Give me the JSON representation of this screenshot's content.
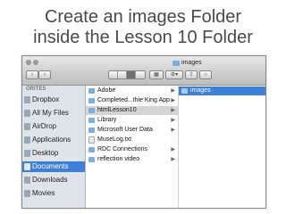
{
  "slide": {
    "title_line1": "Create an images Folder",
    "title_line2": "inside the Lesson 10 Folder"
  },
  "window": {
    "title": "images",
    "title_icon": "folder-icon"
  },
  "toolbar": {
    "view_modes": [
      "icon-view",
      "list-view",
      "column-view",
      "coverflow-view"
    ],
    "active_view": "column-view",
    "action_icon": "gear-icon",
    "arrange_icon": "grid-icon"
  },
  "sidebar": {
    "header": "ORITES",
    "items": [
      {
        "label": "Dropbox",
        "icon": "dropbox-icon"
      },
      {
        "label": "All My Files",
        "icon": "all-files-icon"
      },
      {
        "label": "AirDrop",
        "icon": "airdrop-icon"
      },
      {
        "label": "Applications",
        "icon": "applications-icon"
      },
      {
        "label": "Desktop",
        "icon": "desktop-icon"
      },
      {
        "label": "Documents",
        "icon": "documents-icon",
        "selected": true
      },
      {
        "label": "Downloads",
        "icon": "downloads-icon"
      },
      {
        "label": "Movies",
        "icon": "movies-icon"
      }
    ]
  },
  "column1": {
    "items": [
      {
        "label": "Adobe",
        "type": "folder",
        "has_children": true
      },
      {
        "label": "Completed...thie King App",
        "type": "folder",
        "has_children": true
      },
      {
        "label": "htmlLesson10",
        "type": "folder",
        "has_children": true,
        "selected": true
      },
      {
        "label": "Library",
        "type": "folder",
        "has_children": true
      },
      {
        "label": "Microsoft User Data",
        "type": "folder",
        "has_children": true
      },
      {
        "label": "MuseLog.txt",
        "type": "file",
        "has_children": false
      },
      {
        "label": "RDC Connections",
        "type": "folder",
        "has_children": true
      },
      {
        "label": "reflection video",
        "type": "folder",
        "has_children": true
      }
    ]
  },
  "column2": {
    "items": [
      {
        "label": "images",
        "type": "folder",
        "selected": true
      }
    ]
  },
  "colors": {
    "selection": "#3e7fd8",
    "sidebar_bg": "#dfe4ea",
    "title_text": "#4a4a4a"
  }
}
